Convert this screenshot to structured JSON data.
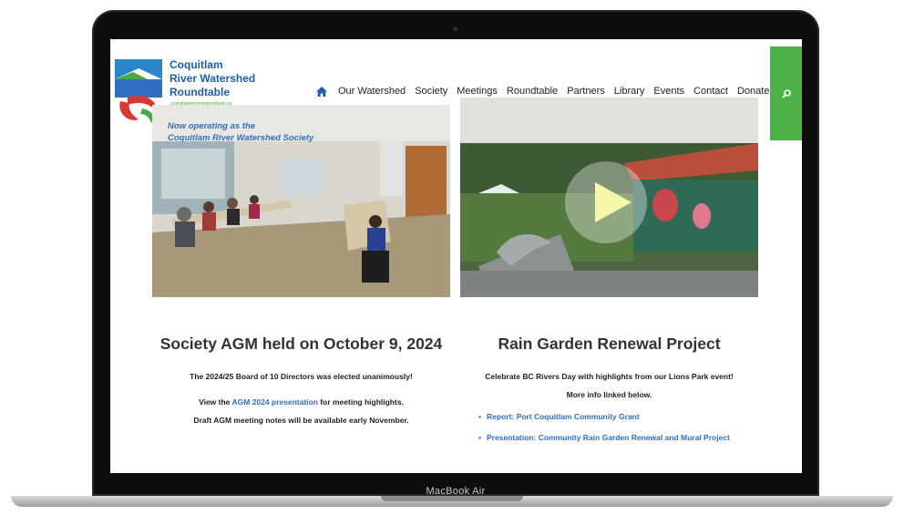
{
  "device": {
    "label": "MacBook Air"
  },
  "header": {
    "logo_lines": [
      "Coquitlam",
      "River Watershed",
      "Roundtable"
    ],
    "logo_url": "coquitlamriverwatershed.ca",
    "tagline_lines": [
      "Now operating as the",
      "Coquitlam River Watershed Society"
    ]
  },
  "nav": {
    "items": [
      "Our Watershed",
      "Society",
      "Meetings",
      "Roundtable",
      "Partners",
      "Library",
      "Events",
      "Contact",
      "Donate"
    ]
  },
  "left_article": {
    "title": "Society AGM held on October 9, 2024",
    "line1": "The 2024/25 Board of 10 Directors was elected unanimously!",
    "line2_prefix": "View the ",
    "line2_link": "AGM 2024 presentation",
    "line2_suffix": " for meeting highlights.",
    "line3": "Draft AGM meeting notes will be available early November."
  },
  "right_article": {
    "title": "Rain Garden Renewal Project",
    "line1": "Celebrate BC Rivers Day with highlights from our Lions Park event!",
    "line2": "More info linked below.",
    "links": [
      "Report: Port Coquitlam Community Grant",
      "Presentation: Community Rain Garden Renewal and Mural Project"
    ]
  },
  "colors": {
    "brand_blue": "#1f5fa9",
    "link_blue": "#2e6fc0",
    "brand_green": "#4db14a"
  }
}
